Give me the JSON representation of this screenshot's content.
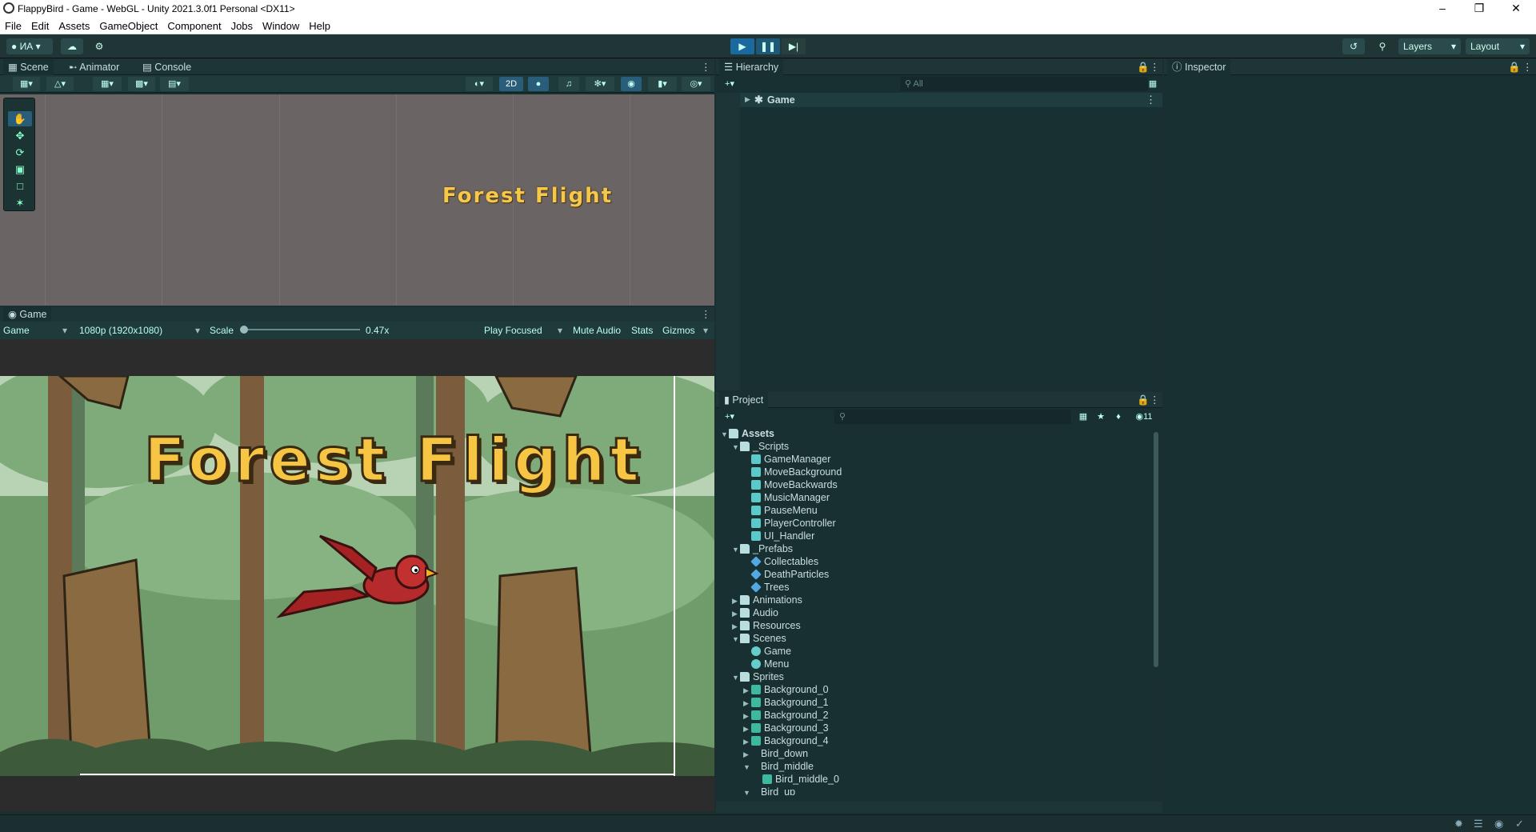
{
  "window": {
    "title": "FlappyBird - Game - WebGL - Unity 2021.3.0f1 Personal <DX11>"
  },
  "menu": [
    "File",
    "Edit",
    "Assets",
    "GameObject",
    "Component",
    "Jobs",
    "Window",
    "Help"
  ],
  "toolbar": {
    "account": "ИА",
    "layers": "Layers",
    "layout": "Layout"
  },
  "tabs": {
    "scene": "Scene",
    "animator": "Animator",
    "console": "Console",
    "game": "Game",
    "hierarchy": "Hierarchy",
    "inspector": "Inspector",
    "project": "Project"
  },
  "scene": {
    "mode2d": "2D",
    "overlay_title": "Forest Flight"
  },
  "gamebar": {
    "display": "Game",
    "resolution": "1080p (1920x1080)",
    "scale_label": "Scale",
    "scale_value": "0.47x",
    "play_focused": "Play Focused",
    "mute": "Mute Audio",
    "stats": "Stats",
    "gizmos": "Gizmos"
  },
  "game": {
    "title": "Forest Flight"
  },
  "hierarchy": {
    "search_placeholder": "All",
    "items": [
      {
        "label": "Game"
      }
    ]
  },
  "project": {
    "count": "11",
    "tree": [
      {
        "label": "Assets",
        "type": "folder",
        "depth": 0,
        "expanded": true
      },
      {
        "label": "_Scripts",
        "type": "folder",
        "depth": 1,
        "expanded": true
      },
      {
        "label": "GameManager",
        "type": "gear",
        "depth": 2
      },
      {
        "label": "MoveBackground",
        "type": "script",
        "depth": 2
      },
      {
        "label": "MoveBackwards",
        "type": "script",
        "depth": 2
      },
      {
        "label": "MusicManager",
        "type": "script",
        "depth": 2
      },
      {
        "label": "PauseMenu",
        "type": "script",
        "depth": 2
      },
      {
        "label": "PlayerController",
        "type": "script",
        "depth": 2
      },
      {
        "label": "UI_Handler",
        "type": "script",
        "depth": 2
      },
      {
        "label": "_Prefabs",
        "type": "folder",
        "depth": 1,
        "expanded": true
      },
      {
        "label": "Collectables",
        "type": "prefab",
        "depth": 2
      },
      {
        "label": "DeathParticles",
        "type": "prefab",
        "depth": 2
      },
      {
        "label": "Trees",
        "type": "prefab",
        "depth": 2
      },
      {
        "label": "Animations",
        "type": "folder",
        "depth": 1,
        "expanded": false
      },
      {
        "label": "Audio",
        "type": "folder",
        "depth": 1,
        "expanded": false
      },
      {
        "label": "Resources",
        "type": "folder",
        "depth": 1,
        "expanded": false
      },
      {
        "label": "Scenes",
        "type": "folder",
        "depth": 1,
        "expanded": true
      },
      {
        "label": "Game",
        "type": "scene",
        "depth": 2
      },
      {
        "label": "Menu",
        "type": "scene",
        "depth": 2
      },
      {
        "label": "Sprites",
        "type": "folder",
        "depth": 1,
        "expanded": true
      },
      {
        "label": "Background_0",
        "type": "sprite",
        "depth": 2,
        "collapsed_child": true
      },
      {
        "label": "Background_1",
        "type": "sprite",
        "depth": 2,
        "collapsed_child": true
      },
      {
        "label": "Background_2",
        "type": "sprite",
        "depth": 2,
        "collapsed_child": true
      },
      {
        "label": "Background_3",
        "type": "sprite",
        "depth": 2,
        "collapsed_child": true
      },
      {
        "label": "Background_4",
        "type": "sprite",
        "depth": 2,
        "collapsed_child": true
      },
      {
        "label": "Bird_down",
        "type": "sprite-empty",
        "depth": 2,
        "collapsed_child": true
      },
      {
        "label": "Bird_middle",
        "type": "sprite-empty",
        "depth": 2,
        "expanded_child": true
      },
      {
        "label": "Bird_middle_0",
        "type": "subsprite",
        "depth": 3
      },
      {
        "label": "Bird_up",
        "type": "sprite-empty",
        "depth": 2,
        "expanded_child": true
      }
    ]
  },
  "colors": {
    "accent": "#2a5d7a",
    "panel": "#193032",
    "title_yellow": "#f6c544"
  }
}
